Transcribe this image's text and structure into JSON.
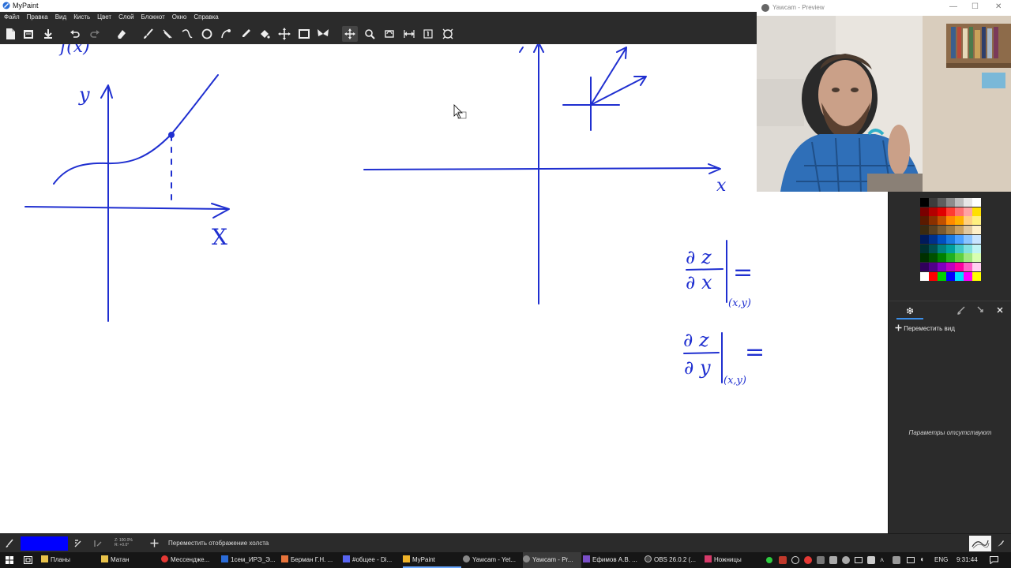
{
  "window": {
    "title": "MyPaint",
    "icon": "mypaint-app-icon"
  },
  "menu": [
    {
      "label": "Файл"
    },
    {
      "label": "Правка"
    },
    {
      "label": "Вид"
    },
    {
      "label": "Кисть"
    },
    {
      "label": "Цвет"
    },
    {
      "label": "Слой"
    },
    {
      "label": "Блокнот"
    },
    {
      "label": "Окно"
    },
    {
      "label": "Справка"
    }
  ],
  "toolbar": [
    "new-document-icon",
    "open-file-icon",
    "save-file-icon",
    "undo-icon",
    "redo-icon",
    "eraser-icon",
    "brush-icon",
    "line-icon",
    "curve-icon",
    "ellipse-icon",
    "inking-icon",
    "color-picker-icon",
    "fill-icon",
    "move-layer-icon",
    "frame-icon",
    "symmetry-icon",
    "pan-view-icon",
    "zoom-view-icon",
    "rotate-view-icon",
    "mirror-view-icon",
    "reset-view-icon",
    "fit-view-icon"
  ],
  "canvas": {
    "ink_color": "#1f2fd0",
    "left_graph": {
      "func_label": "f(x)",
      "y_label": "y",
      "x_label": "X"
    },
    "right_graph": {
      "x_label": "x"
    },
    "partials": {
      "first": {
        "num": "∂ z",
        "den": "∂ x",
        "sub": "(x,y)",
        "eq": "="
      },
      "second": {
        "num": "∂ z",
        "den": "∂ y",
        "sub": "(x,y)",
        "eq": "="
      }
    }
  },
  "webcam": {
    "title": "Yawcam - Preview",
    "buttons": [
      "—",
      "☐",
      "✕"
    ]
  },
  "panel": {
    "palette": [
      [
        "#000000",
        "#3c3c3c",
        "#5e5e5e",
        "#8c8c8c",
        "#bdbdbd",
        "#e6e6e6",
        "#ffffff"
      ],
      [
        "#7a0000",
        "#b30000",
        "#e00000",
        "#ff3b30",
        "#ff7070",
        "#ffa3a3",
        "#ffe000"
      ],
      [
        "#5a1a00",
        "#8a3000",
        "#c05000",
        "#ff8a00",
        "#ffb000",
        "#ffd080",
        "#fff080"
      ],
      [
        "#3a2a10",
        "#5a4020",
        "#7a5a30",
        "#a07a40",
        "#c8a060",
        "#e0c8a0",
        "#fff0c8"
      ],
      [
        "#001a5a",
        "#00308a",
        "#0050c0",
        "#1a7ae0",
        "#4aa0ff",
        "#8ac4ff",
        "#c8e4ff"
      ],
      [
        "#003030",
        "#005050",
        "#008080",
        "#00a0a0",
        "#40c8c8",
        "#80e0e0",
        "#c0f4f4"
      ],
      [
        "#003000",
        "#005000",
        "#008000",
        "#20b020",
        "#60d040",
        "#a0e880",
        "#d8ffb0"
      ],
      [
        "#30005a",
        "#50008a",
        "#8000c0",
        "#c000c0",
        "#ff00a0",
        "#ff60c8",
        "#ffd0f0"
      ],
      [
        "#ffffff",
        "#ff0000",
        "#00d000",
        "#0000ff",
        "#00e0ff",
        "#ff00ff",
        "#ffff00"
      ]
    ],
    "tab_icons": [
      "settings-icon",
      "brush-options-icon",
      "pick-icon",
      "close-icon"
    ],
    "tool_title": "Переместить вид",
    "no_params": "Параметры отсутствуют"
  },
  "status": {
    "color": "#0000ff",
    "zoom_line1": "Z: 100.0%",
    "zoom_line2": "R: +0.0°",
    "text": "Переместить отображение холста"
  },
  "taskbar": {
    "items": [
      {
        "label": "Планы",
        "color": "#e8c24a"
      },
      {
        "label": "Матан",
        "color": "#e8c24a"
      },
      {
        "label": "Мессендже...",
        "color": "#e53935"
      },
      {
        "label": "1сем_ИРЭ_Э...",
        "color": "#2b6cd8"
      },
      {
        "label": "Берман Г.Н. ...",
        "color": "#e8743b"
      },
      {
        "label": "#общее - Di...",
        "color": "#5865f2"
      },
      {
        "label": "MyPaint",
        "color": "#f0b429"
      },
      {
        "label": "Yawcam - Yet...",
        "color": "#888888"
      },
      {
        "label": "Yawcam - Pr...",
        "color": "#888888"
      },
      {
        "label": "Ефимов А.В. ...",
        "color": "#7a4fc8"
      },
      {
        "label": "OBS 26.0.2 (...",
        "color": "#444444"
      },
      {
        "label": "Ножницы",
        "color": "#d63a6a"
      }
    ],
    "active_index": 8,
    "lang": "ENG",
    "clock": "9:31:44"
  }
}
